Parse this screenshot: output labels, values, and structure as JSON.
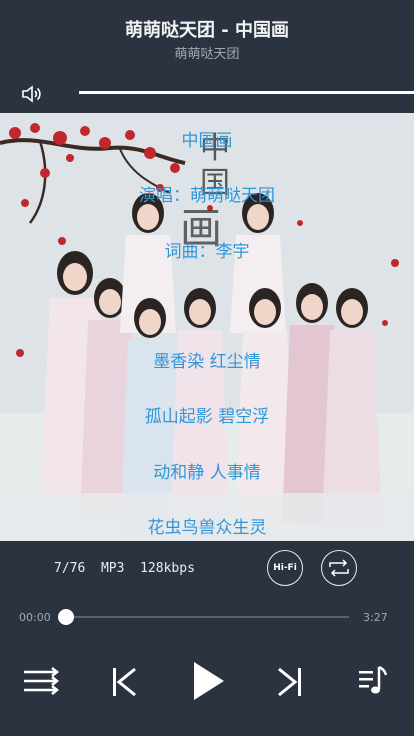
{
  "song": {
    "title": "萌萌哒天团 - 中国画",
    "artist": "萌萌哒天团"
  },
  "volume": {
    "level": 1.0
  },
  "lyrics": [
    "中国画",
    "演唱：萌萌哒天团",
    "词曲：李宇",
    "墨香染 红尘情",
    "孤山起影 碧空浮",
    "动和静 人事情",
    "花虫鸟兽众生灵"
  ],
  "track": {
    "index": "7/76",
    "format": "MP3",
    "bitrate": "128kbps",
    "hifi_label": "Hi-Fi"
  },
  "progress": {
    "current": "00:00",
    "total": "3:27",
    "fraction": 0.0
  },
  "colors": {
    "background": "#2c3340",
    "lyric": "#2f97d8",
    "petal": "#c0282e"
  },
  "icons": [
    "speaker-icon",
    "hifi-icon",
    "repeat-icon",
    "shuffle-icon",
    "previous-icon",
    "play-icon",
    "next-icon",
    "playlist-icon"
  ]
}
